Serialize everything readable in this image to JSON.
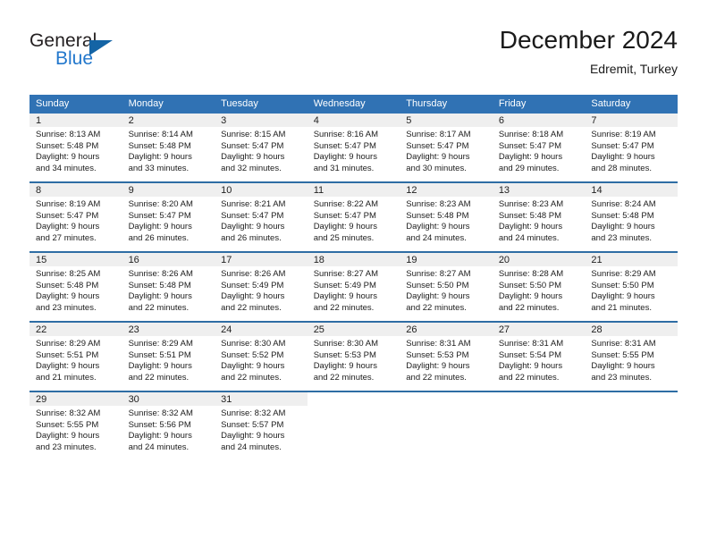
{
  "brand": {
    "name_primary": "General",
    "name_secondary": "Blue",
    "flag_icon": "triangle-flag-icon",
    "accent_color": "#1464a5",
    "secondary_color": "#2277cc"
  },
  "header": {
    "month_title": "December 2024",
    "location": "Edremit, Turkey"
  },
  "theme": {
    "header_row_background": "#3072b4",
    "row_divider_color": "#2e6da4",
    "day_number_strip_background": "#efefef"
  },
  "calendar": {
    "weekday_headers": [
      "Sunday",
      "Monday",
      "Tuesday",
      "Wednesday",
      "Thursday",
      "Friday",
      "Saturday"
    ],
    "weeks": [
      [
        {
          "day": "1",
          "sunrise": "Sunrise: 8:13 AM",
          "sunset": "Sunset: 5:48 PM",
          "daylight_line1": "Daylight: 9 hours",
          "daylight_line2": "and 34 minutes."
        },
        {
          "day": "2",
          "sunrise": "Sunrise: 8:14 AM",
          "sunset": "Sunset: 5:48 PM",
          "daylight_line1": "Daylight: 9 hours",
          "daylight_line2": "and 33 minutes."
        },
        {
          "day": "3",
          "sunrise": "Sunrise: 8:15 AM",
          "sunset": "Sunset: 5:47 PM",
          "daylight_line1": "Daylight: 9 hours",
          "daylight_line2": "and 32 minutes."
        },
        {
          "day": "4",
          "sunrise": "Sunrise: 8:16 AM",
          "sunset": "Sunset: 5:47 PM",
          "daylight_line1": "Daylight: 9 hours",
          "daylight_line2": "and 31 minutes."
        },
        {
          "day": "5",
          "sunrise": "Sunrise: 8:17 AM",
          "sunset": "Sunset: 5:47 PM",
          "daylight_line1": "Daylight: 9 hours",
          "daylight_line2": "and 30 minutes."
        },
        {
          "day": "6",
          "sunrise": "Sunrise: 8:18 AM",
          "sunset": "Sunset: 5:47 PM",
          "daylight_line1": "Daylight: 9 hours",
          "daylight_line2": "and 29 minutes."
        },
        {
          "day": "7",
          "sunrise": "Sunrise: 8:19 AM",
          "sunset": "Sunset: 5:47 PM",
          "daylight_line1": "Daylight: 9 hours",
          "daylight_line2": "and 28 minutes."
        }
      ],
      [
        {
          "day": "8",
          "sunrise": "Sunrise: 8:19 AM",
          "sunset": "Sunset: 5:47 PM",
          "daylight_line1": "Daylight: 9 hours",
          "daylight_line2": "and 27 minutes."
        },
        {
          "day": "9",
          "sunrise": "Sunrise: 8:20 AM",
          "sunset": "Sunset: 5:47 PM",
          "daylight_line1": "Daylight: 9 hours",
          "daylight_line2": "and 26 minutes."
        },
        {
          "day": "10",
          "sunrise": "Sunrise: 8:21 AM",
          "sunset": "Sunset: 5:47 PM",
          "daylight_line1": "Daylight: 9 hours",
          "daylight_line2": "and 26 minutes."
        },
        {
          "day": "11",
          "sunrise": "Sunrise: 8:22 AM",
          "sunset": "Sunset: 5:47 PM",
          "daylight_line1": "Daylight: 9 hours",
          "daylight_line2": "and 25 minutes."
        },
        {
          "day": "12",
          "sunrise": "Sunrise: 8:23 AM",
          "sunset": "Sunset: 5:48 PM",
          "daylight_line1": "Daylight: 9 hours",
          "daylight_line2": "and 24 minutes."
        },
        {
          "day": "13",
          "sunrise": "Sunrise: 8:23 AM",
          "sunset": "Sunset: 5:48 PM",
          "daylight_line1": "Daylight: 9 hours",
          "daylight_line2": "and 24 minutes."
        },
        {
          "day": "14",
          "sunrise": "Sunrise: 8:24 AM",
          "sunset": "Sunset: 5:48 PM",
          "daylight_line1": "Daylight: 9 hours",
          "daylight_line2": "and 23 minutes."
        }
      ],
      [
        {
          "day": "15",
          "sunrise": "Sunrise: 8:25 AM",
          "sunset": "Sunset: 5:48 PM",
          "daylight_line1": "Daylight: 9 hours",
          "daylight_line2": "and 23 minutes."
        },
        {
          "day": "16",
          "sunrise": "Sunrise: 8:26 AM",
          "sunset": "Sunset: 5:48 PM",
          "daylight_line1": "Daylight: 9 hours",
          "daylight_line2": "and 22 minutes."
        },
        {
          "day": "17",
          "sunrise": "Sunrise: 8:26 AM",
          "sunset": "Sunset: 5:49 PM",
          "daylight_line1": "Daylight: 9 hours",
          "daylight_line2": "and 22 minutes."
        },
        {
          "day": "18",
          "sunrise": "Sunrise: 8:27 AM",
          "sunset": "Sunset: 5:49 PM",
          "daylight_line1": "Daylight: 9 hours",
          "daylight_line2": "and 22 minutes."
        },
        {
          "day": "19",
          "sunrise": "Sunrise: 8:27 AM",
          "sunset": "Sunset: 5:50 PM",
          "daylight_line1": "Daylight: 9 hours",
          "daylight_line2": "and 22 minutes."
        },
        {
          "day": "20",
          "sunrise": "Sunrise: 8:28 AM",
          "sunset": "Sunset: 5:50 PM",
          "daylight_line1": "Daylight: 9 hours",
          "daylight_line2": "and 22 minutes."
        },
        {
          "day": "21",
          "sunrise": "Sunrise: 8:29 AM",
          "sunset": "Sunset: 5:50 PM",
          "daylight_line1": "Daylight: 9 hours",
          "daylight_line2": "and 21 minutes."
        }
      ],
      [
        {
          "day": "22",
          "sunrise": "Sunrise: 8:29 AM",
          "sunset": "Sunset: 5:51 PM",
          "daylight_line1": "Daylight: 9 hours",
          "daylight_line2": "and 21 minutes."
        },
        {
          "day": "23",
          "sunrise": "Sunrise: 8:29 AM",
          "sunset": "Sunset: 5:51 PM",
          "daylight_line1": "Daylight: 9 hours",
          "daylight_line2": "and 22 minutes."
        },
        {
          "day": "24",
          "sunrise": "Sunrise: 8:30 AM",
          "sunset": "Sunset: 5:52 PM",
          "daylight_line1": "Daylight: 9 hours",
          "daylight_line2": "and 22 minutes."
        },
        {
          "day": "25",
          "sunrise": "Sunrise: 8:30 AM",
          "sunset": "Sunset: 5:53 PM",
          "daylight_line1": "Daylight: 9 hours",
          "daylight_line2": "and 22 minutes."
        },
        {
          "day": "26",
          "sunrise": "Sunrise: 8:31 AM",
          "sunset": "Sunset: 5:53 PM",
          "daylight_line1": "Daylight: 9 hours",
          "daylight_line2": "and 22 minutes."
        },
        {
          "day": "27",
          "sunrise": "Sunrise: 8:31 AM",
          "sunset": "Sunset: 5:54 PM",
          "daylight_line1": "Daylight: 9 hours",
          "daylight_line2": "and 22 minutes."
        },
        {
          "day": "28",
          "sunrise": "Sunrise: 8:31 AM",
          "sunset": "Sunset: 5:55 PM",
          "daylight_line1": "Daylight: 9 hours",
          "daylight_line2": "and 23 minutes."
        }
      ],
      [
        {
          "day": "29",
          "sunrise": "Sunrise: 8:32 AM",
          "sunset": "Sunset: 5:55 PM",
          "daylight_line1": "Daylight: 9 hours",
          "daylight_line2": "and 23 minutes."
        },
        {
          "day": "30",
          "sunrise": "Sunrise: 8:32 AM",
          "sunset": "Sunset: 5:56 PM",
          "daylight_line1": "Daylight: 9 hours",
          "daylight_line2": "and 24 minutes."
        },
        {
          "day": "31",
          "sunrise": "Sunrise: 8:32 AM",
          "sunset": "Sunset: 5:57 PM",
          "daylight_line1": "Daylight: 9 hours",
          "daylight_line2": "and 24 minutes."
        },
        {
          "day": "",
          "sunrise": "",
          "sunset": "",
          "daylight_line1": "",
          "daylight_line2": ""
        },
        {
          "day": "",
          "sunrise": "",
          "sunset": "",
          "daylight_line1": "",
          "daylight_line2": ""
        },
        {
          "day": "",
          "sunrise": "",
          "sunset": "",
          "daylight_line1": "",
          "daylight_line2": ""
        },
        {
          "day": "",
          "sunrise": "",
          "sunset": "",
          "daylight_line1": "",
          "daylight_line2": ""
        }
      ]
    ]
  }
}
